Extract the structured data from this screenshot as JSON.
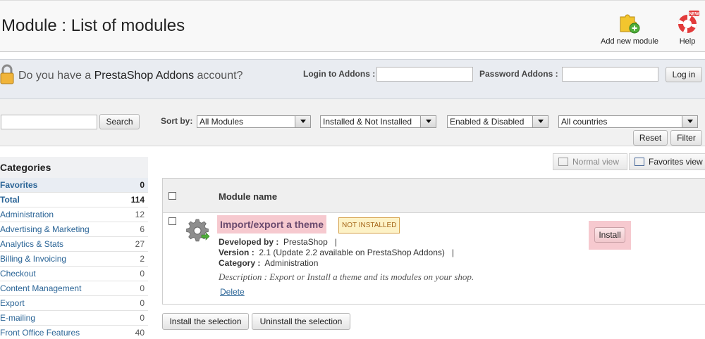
{
  "header": {
    "title": "Module : List of modules",
    "add_module_label": "Add new module",
    "help_label": "Help",
    "help_badge": "NEW"
  },
  "addons": {
    "question_pre": "Do you have a ",
    "question_brand": "PrestaShop Addons",
    "question_post": " account?",
    "login_label": "Login to Addons :",
    "login_value": "",
    "password_label": "Password Addons :",
    "password_value": "",
    "login_button": "Log in"
  },
  "filters": {
    "search_value": "",
    "search_button": "Search",
    "sort_label": "Sort by:",
    "sort_value": "All Modules",
    "install_value": "Installed & Not Installed",
    "enabled_value": "Enabled & Disabled",
    "country_value": "All countries",
    "reset_button": "Reset",
    "filter_button": "Filter"
  },
  "categories": {
    "title": "Categories",
    "items": [
      {
        "label": "Favorites",
        "count": "0"
      },
      {
        "label": "Total",
        "count": "114"
      },
      {
        "label": "Administration",
        "count": "12"
      },
      {
        "label": "Advertising & Marketing",
        "count": "6"
      },
      {
        "label": "Analytics & Stats",
        "count": "27"
      },
      {
        "label": "Billing & Invoicing",
        "count": "2"
      },
      {
        "label": "Checkout",
        "count": "0"
      },
      {
        "label": "Content Management",
        "count": "0"
      },
      {
        "label": "Export",
        "count": "0"
      },
      {
        "label": "E-mailing",
        "count": "0"
      },
      {
        "label": "Front Office Features",
        "count": "40"
      }
    ]
  },
  "views": {
    "normal": "Normal view",
    "favorites": "Favorites view"
  },
  "table": {
    "header": "Module name"
  },
  "module": {
    "name": "Import/export a theme",
    "status": "NOT INSTALLED",
    "developed_label": "Developed by :",
    "developed_value": "PrestaShop",
    "version_label": "Version :",
    "version_value": "2.1 (Update 2.2 available on PrestaShop Addons)",
    "category_label": "Category :",
    "category_value": "Administration",
    "description": "Description : Export or Install a theme and its modules on your shop.",
    "delete_label": "Delete",
    "install_label": "Install"
  },
  "bulk": {
    "install": "Install the selection",
    "uninstall": "Uninstall the selection"
  },
  "colors": {
    "highlight": "#f6c9cf",
    "link": "#2a6496",
    "badge_bg": "#fdf2c6",
    "badge_text": "#a6671a"
  }
}
